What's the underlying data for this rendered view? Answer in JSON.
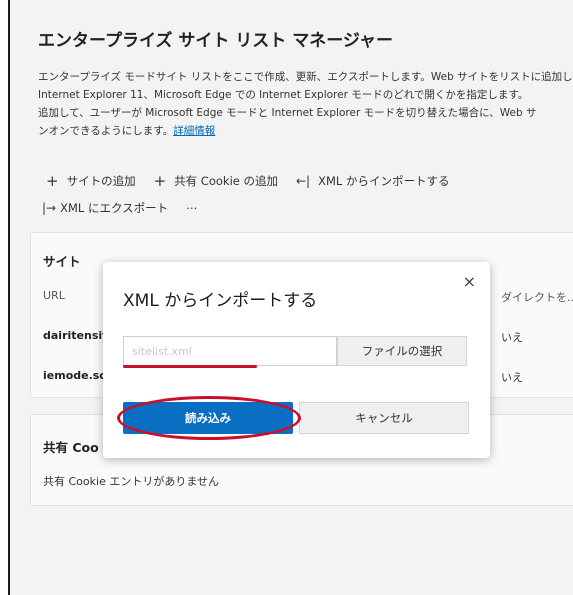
{
  "header": {
    "title": "エンタープライズ サイト リスト マネージャー",
    "description_1": "エンタープライズ モードサイト リストをここで作成、更新、エクスポートします。Web サイトをリストに追加し",
    "description_2": "Internet Explorer 11、Microsoft Edge での Internet Explorer モードのどれで開くかを指定します。",
    "description_3": "追加して、ユーザーが Microsoft Edge モードと Internet Explorer モードを切り替えた場合に、Web サ",
    "description_4": "ンオンできるようにします。",
    "learn_more": "詳細情報"
  },
  "toolbar": {
    "add_site": "サイトの追加",
    "add_cookie": "共有 Cookie の追加",
    "import_xml": "XML からインポートする",
    "export_xml": "XML にエクスポート",
    "more": "⋯"
  },
  "sites_card": {
    "title": "サイト",
    "columns": {
      "url": "URL",
      "redirect": "ダイレクトを..."
    },
    "rows": [
      {
        "url": "dairitensit",
        "redirect": "いえ"
      },
      {
        "url": "iemode.sc",
        "redirect": "いえ"
      }
    ]
  },
  "cookies_card": {
    "title": "共有 Coo",
    "empty": "共有 Cookie エントリがありません"
  },
  "dialog": {
    "title": "XML からインポートする",
    "file_placeholder": "sitelist.xml",
    "choose_file": "ファイルの選択",
    "load": "読み込み",
    "cancel": "キャンセル",
    "close": "×"
  },
  "icons": {
    "plus": "+",
    "import_arrow": "←|",
    "export_arrow": "|→"
  },
  "colors": {
    "primary": "#0a6fc2",
    "highlight": "#c8102e",
    "link": "#0067b8"
  }
}
